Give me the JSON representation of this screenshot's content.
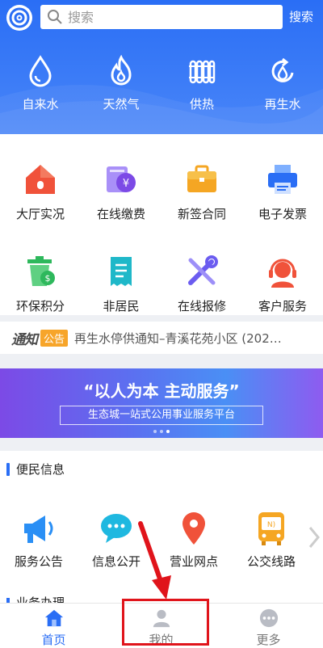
{
  "search": {
    "placeholder": "搜索",
    "button_label": "搜索"
  },
  "utilities": [
    {
      "label": "自来水",
      "icon": "water-drop-icon"
    },
    {
      "label": "天然气",
      "icon": "flame-icon"
    },
    {
      "label": "供热",
      "icon": "radiator-icon"
    },
    {
      "label": "再生水",
      "icon": "recycled-water-icon"
    }
  ],
  "services_row1": [
    {
      "label": "大厅实况",
      "icon": "hall-house-icon",
      "color": "#f0523a"
    },
    {
      "label": "在线缴费",
      "icon": "payment-yen-icon",
      "color": "#8b5cf6"
    },
    {
      "label": "新签合同",
      "icon": "briefcase-icon",
      "color": "#f5a623"
    },
    {
      "label": "电子发票",
      "icon": "printer-icon",
      "color": "#2a6ef5"
    }
  ],
  "services_row2": [
    {
      "label": "环保积分",
      "icon": "recycle-bin-icon",
      "color": "#2eb85c"
    },
    {
      "label": "非居民",
      "icon": "receipt-icon",
      "color": "#1fb8c9"
    },
    {
      "label": "在线报修",
      "icon": "repair-tools-icon",
      "color": "#6b5cf0"
    },
    {
      "label": "客户服务",
      "icon": "customer-service-icon",
      "color": "#f0523a"
    }
  ],
  "notice": {
    "brand": "通知",
    "tag": "公告",
    "text": "再生水停供通知–青溪花苑小区 (202…"
  },
  "banner": {
    "title": "“以人为本 主动服务”",
    "subtitle": "生态城一站式公用事业服务平台"
  },
  "convenience": {
    "title": "便民信息",
    "items": [
      {
        "label": "服务公告",
        "icon": "megaphone-icon",
        "color": "#2a8ff5"
      },
      {
        "label": "信息公开",
        "icon": "chat-bubble-icon",
        "color": "#1fb8e0"
      },
      {
        "label": "营业网点",
        "icon": "location-pin-icon",
        "color": "#f0523a"
      },
      {
        "label": "公交线路",
        "icon": "bus-icon",
        "color": "#f5a623"
      }
    ]
  },
  "business": {
    "title": "业务办理"
  },
  "bottom_nav": [
    {
      "label": "首页",
      "icon": "home-icon",
      "active": true
    },
    {
      "label": "我的",
      "icon": "user-icon",
      "active": false
    },
    {
      "label": "更多",
      "icon": "more-icon",
      "active": false
    }
  ],
  "colors": {
    "primary": "#2a6ef5",
    "annotation": "#e0141b"
  }
}
